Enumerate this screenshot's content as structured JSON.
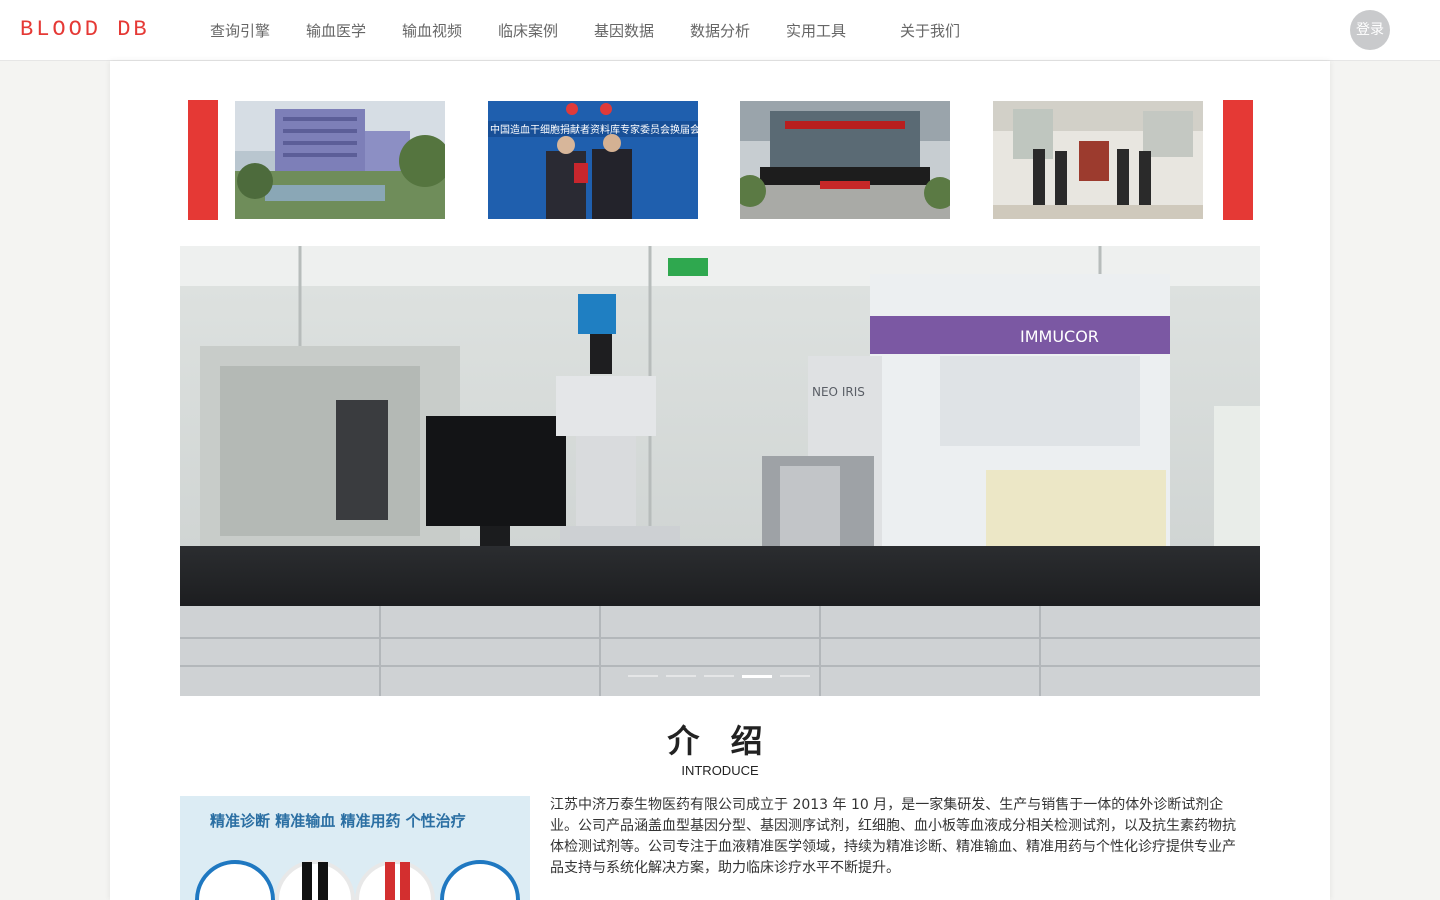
{
  "header": {
    "logo_text": "BLOOD DB",
    "nav": [
      {
        "label": "查询引擎"
      },
      {
        "label": "输血医学"
      },
      {
        "label": "输血视频"
      },
      {
        "label": "临床案例"
      },
      {
        "label": "基因数据"
      },
      {
        "label": "数据分析"
      },
      {
        "label": "实用工具"
      },
      {
        "label": "关于我们"
      }
    ],
    "login_label": "登录"
  },
  "carousel": {
    "thumbnails": [
      {
        "image": "building-exterior-photo"
      },
      {
        "image": "award-ceremony-photo",
        "banner_text": "中国造血干细胞捐献者资料库专家委员会换届会议"
      },
      {
        "image": "group-photo-entrance"
      },
      {
        "image": "group-photo-lobby"
      }
    ],
    "hero_image": "laboratory-equipment-photo",
    "hero_labels": {
      "brand1": "IMMUCOR",
      "brand2": "NEO IRIS"
    },
    "slide_count": 5,
    "active_slide": 4
  },
  "intro": {
    "title": "介 绍",
    "subtitle": "INTRODUCE",
    "image_caption": "精准诊断  精准输血  精准用药  个性治疗",
    "text": "江苏中济万泰生物医药有限公司成立于 2013 年 10 月，是一家集研发、生产与销售于一体的体外诊断试剂企业。公司产品涵盖血型基因分型、基因测序试剂，红细胞、血小板等血液成分相关检测试剂，以及抗生素药物抗体检测试剂等。公司专注于血液精准医学领域，持续为精准诊断、精准输血、精准用药与个性化诊疗提供专业产品支持与系统化解决方案，助力临床诊疗水平不断提升。"
  },
  "colors": {
    "brand_red": "#e53935",
    "nav_text": "#666666",
    "login_bg": "#c9cacc"
  }
}
